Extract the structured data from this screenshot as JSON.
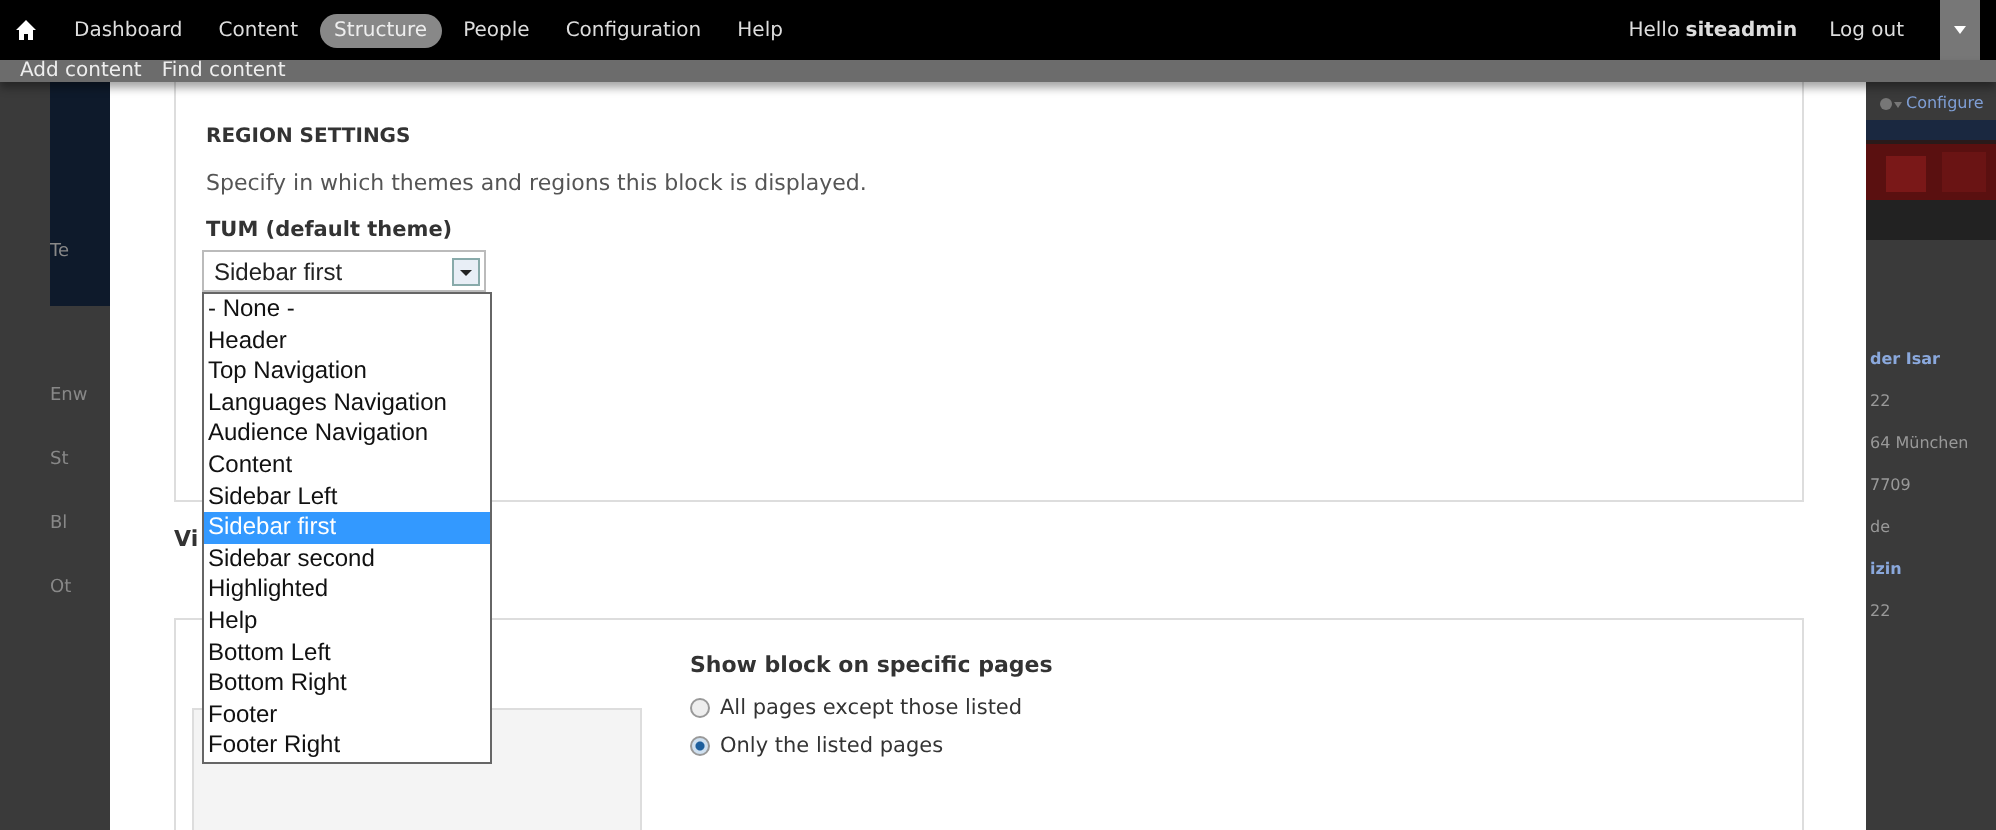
{
  "toolbar": {
    "menu": [
      {
        "label": "Dashboard",
        "selected": false
      },
      {
        "label": "Content",
        "selected": false
      },
      {
        "label": "Structure",
        "selected": true
      },
      {
        "label": "People",
        "selected": false
      },
      {
        "label": "Configuration",
        "selected": false
      },
      {
        "label": "Help",
        "selected": false
      }
    ],
    "greeting": "Hello **siteadmin**",
    "logout": "Log out"
  },
  "shortcuts": [
    "Add content",
    "Find content"
  ],
  "background_left": [
    "Te",
    "Enw",
    "St",
    "Bl",
    "Ot"
  ],
  "background_right": {
    "configure": "Configure",
    "lines": [
      "der Isar",
      "22",
      "64 München",
      "7709",
      "de",
      "izin",
      "22"
    ]
  },
  "region_settings": {
    "title": "REGION SETTINGS",
    "description": "Specify in which themes and regions this block is displayed.",
    "theme_label": "TUM (default theme)",
    "select_value": "Sidebar first",
    "options": [
      {
        "label": "- None -",
        "selected": false
      },
      {
        "label": "Header",
        "selected": false
      },
      {
        "label": "Top Navigation",
        "selected": false
      },
      {
        "label": "Languages Navigation",
        "selected": false
      },
      {
        "label": "Audience Navigation",
        "selected": false
      },
      {
        "label": "Content",
        "selected": false
      },
      {
        "label": "Sidebar Left",
        "selected": false
      },
      {
        "label": "Sidebar first",
        "selected": true
      },
      {
        "label": "Sidebar second",
        "selected": false
      },
      {
        "label": "Highlighted",
        "selected": false
      },
      {
        "label": "Help",
        "selected": false
      },
      {
        "label": "Bottom Left",
        "selected": false
      },
      {
        "label": "Bottom Right",
        "selected": false
      },
      {
        "label": "Footer",
        "selected": false
      },
      {
        "label": "Footer Right",
        "selected": false
      }
    ]
  },
  "visibility": {
    "heading": "Vi",
    "pages_title": "Show block on specific pages",
    "radios": [
      {
        "label": "All pages except those listed",
        "selected": false
      },
      {
        "label": "Only the listed pages",
        "selected": true
      }
    ]
  }
}
